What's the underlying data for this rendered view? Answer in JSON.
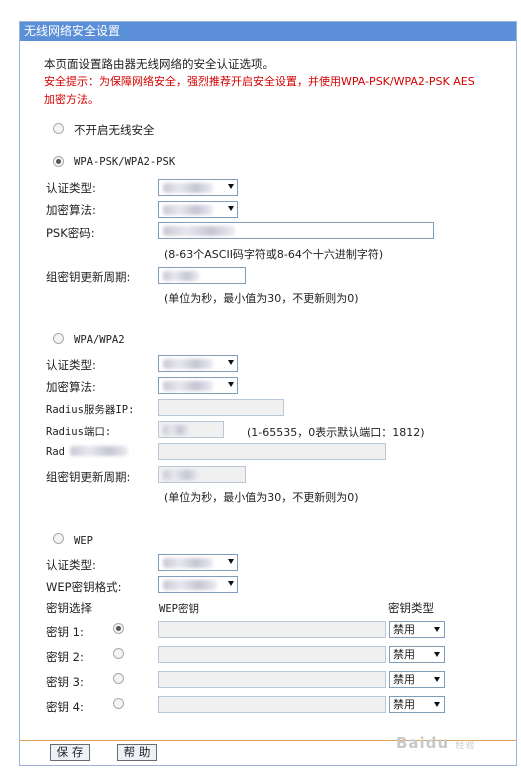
{
  "window": {
    "title": "无线网络安全设置"
  },
  "intro": {
    "description": "本页面设置路由器无线网络的安全认证选项。",
    "warning_line1": "安全提示：为保障网络安全，强烈推荐开启安全设置，并使用WPA-PSK/WPA2-PSK AES",
    "warning_line2": "加密方法。"
  },
  "options": {
    "none_label": "不开启无线安全",
    "wpa_psk_label": "WPA-PSK/WPA2-PSK",
    "wpa_label": "WPA/WPA2",
    "wep_label": "WEP",
    "selected": "WPA-PSK/WPA2-PSK"
  },
  "wpa_psk": {
    "auth_label": "认证类型:",
    "encrypt_label": "加密算法:",
    "psk_label": "PSK密码:",
    "psk_hint": "(8-63个ASCII码字符或8-64个十六进制字符)",
    "renew_label": "组密钥更新周期:",
    "renew_hint": "(单位为秒，最小值为30，不更新则为0)"
  },
  "wpa": {
    "auth_label": "认证类型:",
    "encrypt_label": "加密算法:",
    "radius_ip_label": "Radius服务器IP:",
    "radius_port_label": "Radius端口:",
    "radius_port_hint": "(1-65535，0表示默认端口：1812)",
    "radius_pwd_label": "Rad",
    "renew_label": "组密钥更新周期:",
    "renew_hint": "(单位为秒，最小值为30，不更新则为0)"
  },
  "wep": {
    "auth_label": "认证类型:",
    "format_label": "WEP密钥格式:",
    "col_key_select": "密钥选择",
    "col_wep_key": "WEP密钥",
    "col_key_type": "密钥类型",
    "keys": [
      {
        "label": "密钥 1:",
        "type": "禁用"
      },
      {
        "label": "密钥 2:",
        "type": "禁用"
      },
      {
        "label": "密钥 3:",
        "type": "禁用"
      },
      {
        "label": "密钥 4:",
        "type": "禁用"
      }
    ]
  },
  "buttons": {
    "save": "保 存",
    "help": "帮 助"
  },
  "watermark": {
    "brand": "Bai",
    "suffix": "du",
    "sub": "经验"
  }
}
